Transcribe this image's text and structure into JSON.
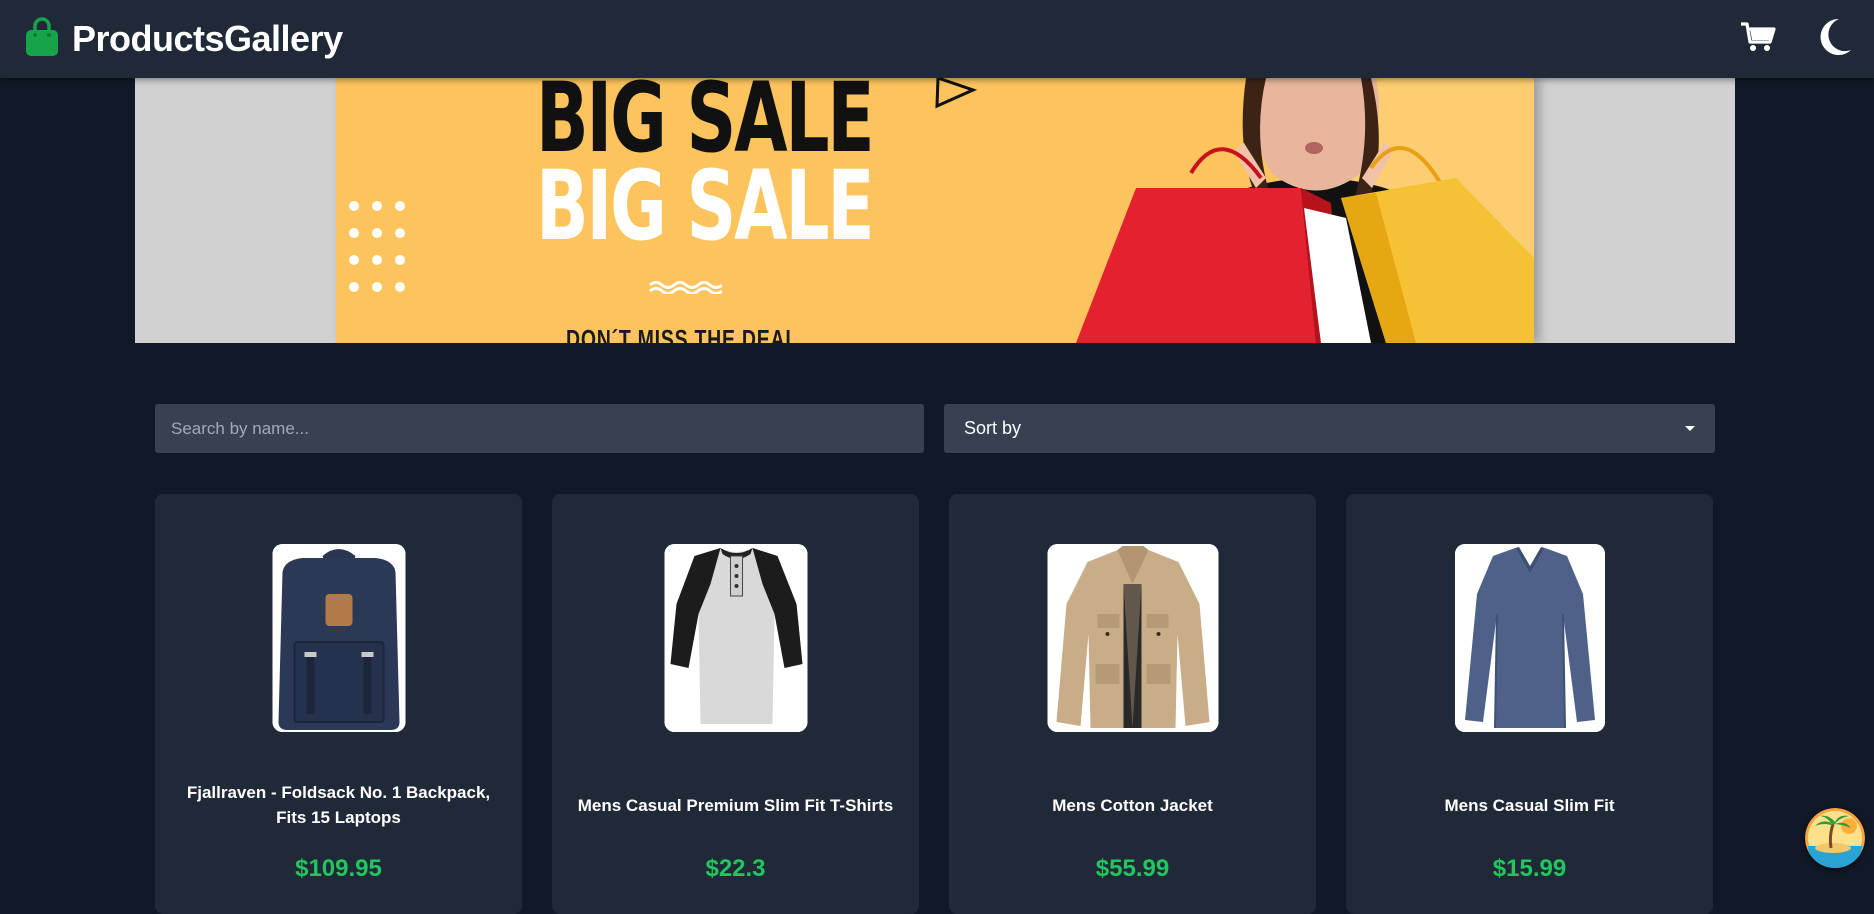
{
  "app": {
    "title": "ProductsGallery"
  },
  "header": {
    "logo_icon": "shopping-bag-icon",
    "cart_icon": "cart-icon",
    "theme_icon": "moon-icon"
  },
  "banner": {
    "line1": "BIG SALE",
    "line2": "BIG SALE",
    "tagline": "DON´T MISS THE DEAL"
  },
  "search": {
    "placeholder": "Search by name...",
    "value": ""
  },
  "sort": {
    "label": "Sort by"
  },
  "products": [
    {
      "title": "Fjallraven - Foldsack No. 1 Backpack, Fits 15 Laptops",
      "price": "$109.95",
      "image": "backpack"
    },
    {
      "title": "Mens Casual Premium Slim Fit T-Shirts",
      "price": "$22.3",
      "image": "raglan-shirt"
    },
    {
      "title": "Mens Cotton Jacket",
      "price": "$55.99",
      "image": "jacket"
    },
    {
      "title": "Mens Casual Slim Fit",
      "price": "$15.99",
      "image": "long-sleeve-shirt"
    }
  ],
  "colors": {
    "navbar": "#1f2937",
    "background": "#111827",
    "card": "#1f2937",
    "input": "#374151",
    "brand_green": "#16a34a",
    "price_green": "#22c55e",
    "banner_yellow": "#fdc45e"
  }
}
